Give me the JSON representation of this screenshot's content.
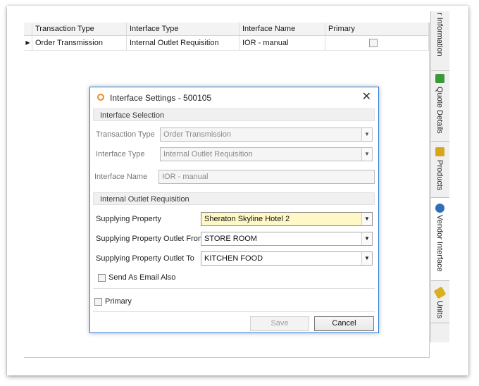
{
  "grid": {
    "headers": [
      "Transaction Type",
      "Interface Type",
      "Interface Name",
      "Primary"
    ],
    "rows": [
      {
        "marker": "▶",
        "transaction_type": "Order Transmission",
        "interface_type": "Internal Outlet Requisition",
        "interface_name": "IOR - manual",
        "primary": false
      }
    ]
  },
  "side_tabs": [
    {
      "label": "r Information",
      "icon": null,
      "active": false
    },
    {
      "label": "Quote Details",
      "icon": "quote-details-icon",
      "icon_color": "#3a9a3a",
      "active": false
    },
    {
      "label": "Products",
      "icon": "products-icon",
      "icon_color": "#d8a61a",
      "active": false
    },
    {
      "label": "Vendor Interface",
      "icon": "vendor-interface-icon",
      "icon_color": "#2f6fb6",
      "active": true
    },
    {
      "label": "Units",
      "icon": "units-icon",
      "icon_color": "#d8b020",
      "active": false
    }
  ],
  "dialog": {
    "title": "Interface Settings - 500105",
    "close": "✕",
    "sections": {
      "selection": "Interface Selection",
      "ior": "Internal Outlet Requisition"
    },
    "fields": {
      "transaction_type": {
        "label": "Transaction Type",
        "value": "Order Transmission"
      },
      "interface_type": {
        "label": "Interface Type",
        "value": "Internal Outlet Requisition"
      },
      "interface_name": {
        "label": "Interface Name",
        "value": "IOR - manual"
      },
      "supplying_property": {
        "label": "Supplying Property",
        "value": "Sheraton Skyline Hotel 2"
      },
      "outlet_from": {
        "label": "Supplying Property Outlet From",
        "value": "STORE ROOM"
      },
      "outlet_to": {
        "label": "Supplying Property Outlet To",
        "value": "KITCHEN FOOD"
      }
    },
    "send_email": {
      "label": "Send As Email Also",
      "checked": false
    },
    "primary": {
      "label": "Primary",
      "checked": false
    },
    "buttons": {
      "save": "Save",
      "cancel": "Cancel"
    }
  },
  "dropdown_glyph": "▼"
}
